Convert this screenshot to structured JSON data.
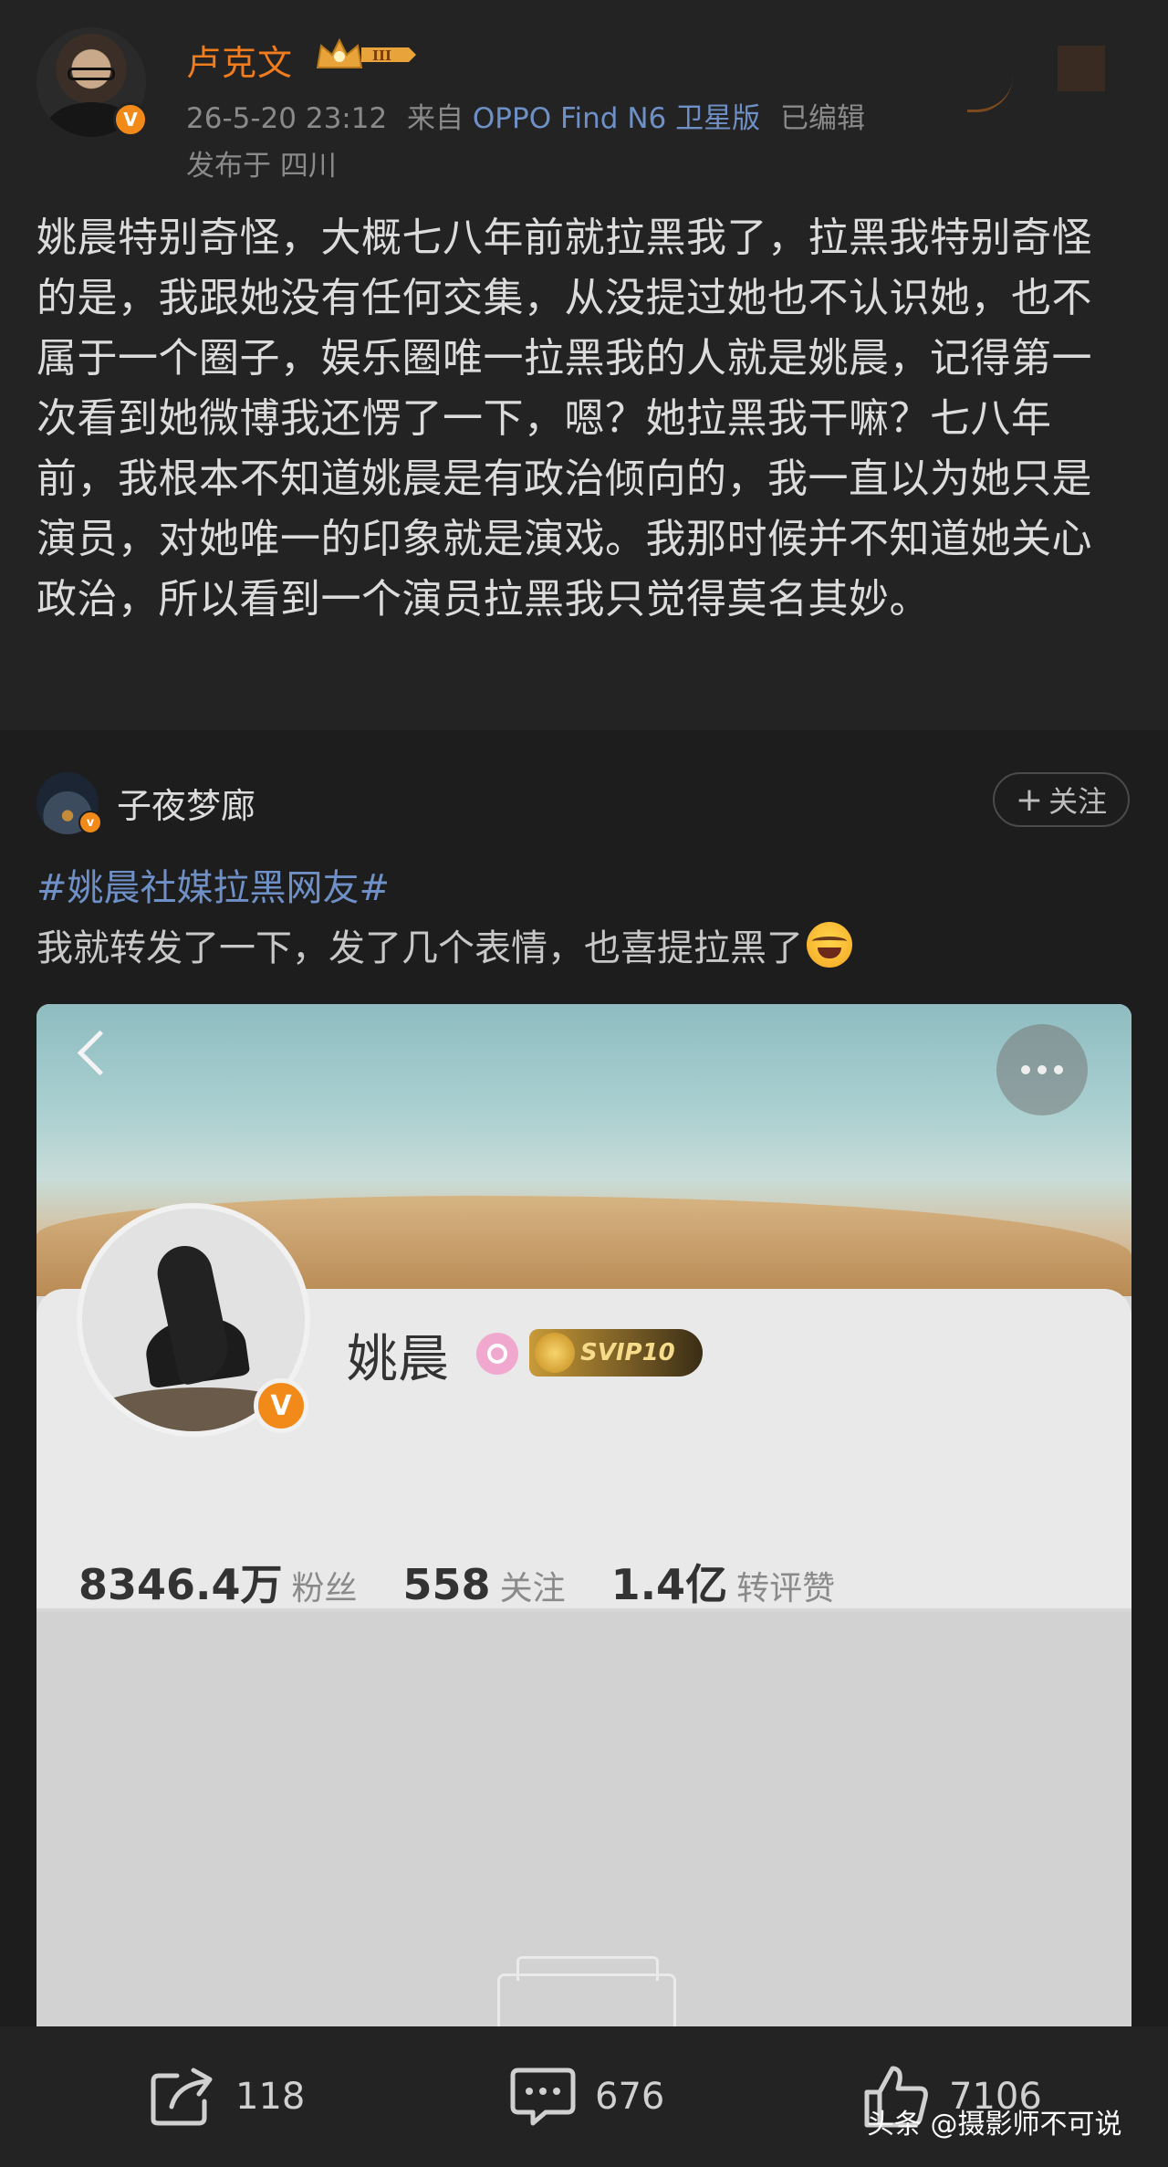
{
  "post": {
    "username": "卢克文",
    "level_badge": "III",
    "date": "26-5-20 23:12",
    "source_prefix": "来自",
    "device": "OPPO Find N6 卫星版",
    "edited": "已编辑",
    "location": "发布于 四川",
    "text": "姚晨特别奇怪，大概七八年前就拉黑我了，拉黑我特别奇怪的是，我跟她没有任何交集，从没提过她也不认识她，也不属于一个圈子，娱乐圈唯一拉黑我的人就是姚晨，记得第一次看到她微博我还愣了一下，嗯？她拉黑我干嘛？七八年前，我根本不知道姚晨是有政治倾向的，我一直以为她只是演员，对她唯一的印象就是演戏。我那时候并不知道她关心政治，所以看到一个演员拉黑我只觉得莫名其妙。"
  },
  "repost": {
    "username": "子夜梦廊",
    "follow_label": "关注",
    "hashtag": "#姚晨社媒拉黑网友#",
    "text": "我就转发了一下，发了几个表情，也喜提拉黑了",
    "emoji_icon": "laugh-cry-emoji"
  },
  "screenshot": {
    "profile_name": "姚晨",
    "svip_label": "SVIP10",
    "stats": [
      {
        "value": "8346.4万",
        "label": "粉丝"
      },
      {
        "value": "558",
        "label": "关注"
      },
      {
        "value": "1.4亿",
        "label": "转评赞"
      }
    ]
  },
  "actions": {
    "share_count": "118",
    "comment_count": "676",
    "like_count": "7106"
  },
  "watermark": "头条 @摄影师不可说",
  "colors": {
    "username_orange": "#f07c1e",
    "link_blue": "#6f90c6",
    "background": "#1d1d1d"
  }
}
